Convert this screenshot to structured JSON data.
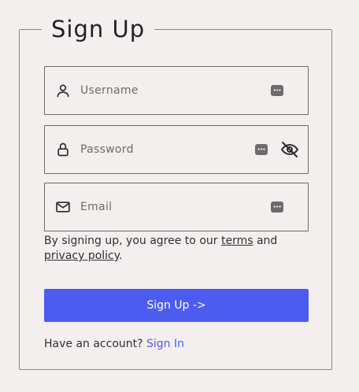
{
  "form": {
    "title": "Sign Up",
    "fields": {
      "username": {
        "placeholder": "Username",
        "icon": "user-icon"
      },
      "password": {
        "placeholder": "Password",
        "icon": "lock-icon",
        "toggle_icon": "eye-off-icon"
      },
      "email": {
        "placeholder": "Email",
        "icon": "mail-icon"
      }
    },
    "terms": {
      "prefix": "By signing up, you agree to our ",
      "terms_link": "terms",
      "middle": " and ",
      "privacy_link": "privacy policy",
      "suffix": "."
    },
    "submit_label": "Sign Up ->",
    "footer": {
      "prompt": "Have an account? ",
      "signin_link": "Sign In"
    }
  },
  "colors": {
    "background": "#f4efef",
    "accent": "#4d5cf0",
    "border": "#6e6868",
    "text": "#2f2f2f"
  }
}
